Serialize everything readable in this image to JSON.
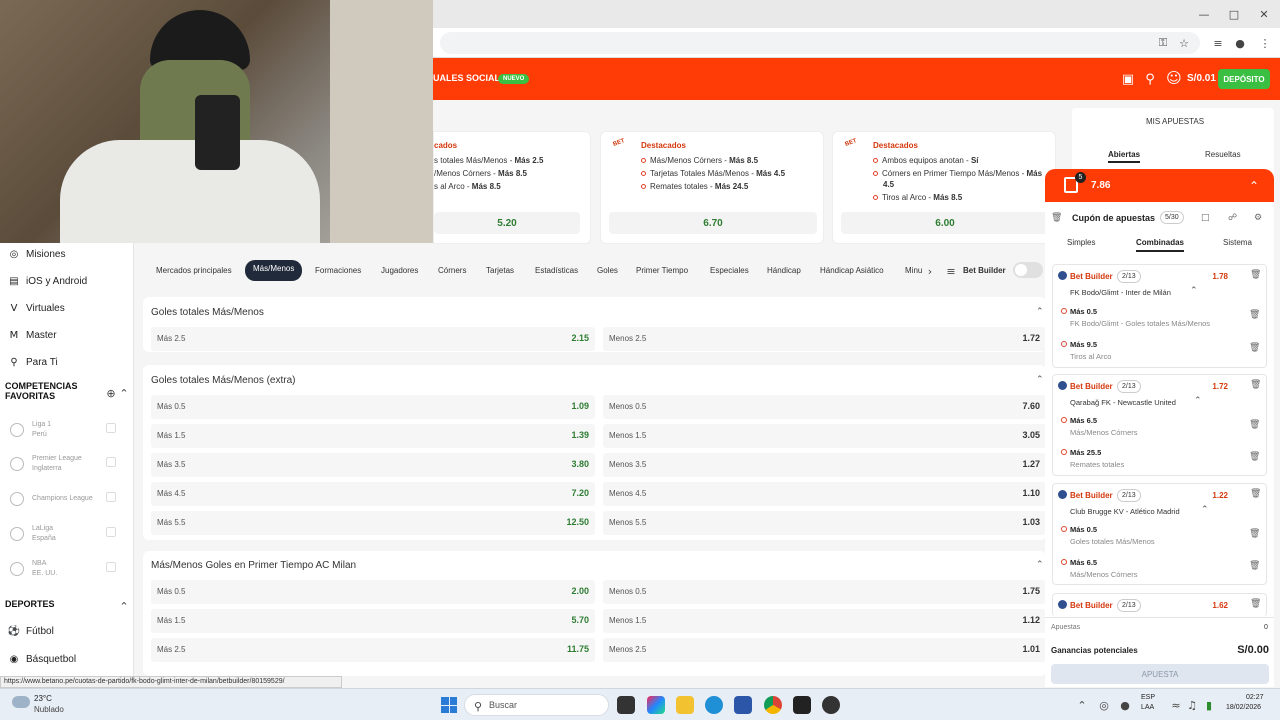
{
  "header": {
    "nav_partial": "UALES",
    "social": "SOCIAL",
    "nuevo_badge": "NUEVO",
    "balance": "S/0.01",
    "deposit": "DEPÓSITO"
  },
  "featured": [
    {
      "title": "cados",
      "lines": [
        {
          "text": "s totales Más/Menos - ",
          "bold": "Más 2.5"
        },
        {
          "text": "/Menos Córners - ",
          "bold": "Más 8.5"
        },
        {
          "text": "s al Arco - ",
          "bold": "Más 8.5"
        }
      ],
      "odds": "5.20"
    },
    {
      "title": "Destacados",
      "lines": [
        {
          "text": "Más/Menos Córners - ",
          "bold": "Más 8.5"
        },
        {
          "text": "Tarjetas Totales Más/Menos - ",
          "bold": "Más 4.5"
        },
        {
          "text": "Remates totales - ",
          "bold": "Más 24.5"
        }
      ],
      "odds": "6.70"
    },
    {
      "title": "Destacados",
      "lines": [
        {
          "text": "Ambos equipos anotan - ",
          "bold": "Sí"
        },
        {
          "text": "Córners en Primer Tiempo Más/Menos - ",
          "bold": "Más"
        },
        {
          "text": "",
          "bold": "4.5"
        },
        {
          "text": "Tiros al Arco - ",
          "bold": "Más 8.5"
        }
      ],
      "odds": "6.00"
    }
  ],
  "sidebar": {
    "items": [
      {
        "label": "Misiones",
        "icon": "target-icon"
      },
      {
        "label": "iOS y Android",
        "icon": "phone-icon"
      },
      {
        "label": "Virtuales",
        "icon": "virtual-icon"
      },
      {
        "label": "Master",
        "icon": "master-icon"
      },
      {
        "label": "Para Ti",
        "icon": "search-icon"
      }
    ],
    "competitions_title": "COMPETENCIAS FAVORITAS",
    "competitions": [
      {
        "name": "Liga 1",
        "sub": "Perú"
      },
      {
        "name": "Premier League",
        "sub": "Inglaterra"
      },
      {
        "name": "Champions League",
        "sub": ""
      },
      {
        "name": "LaLiga",
        "sub": "España"
      },
      {
        "name": "NBA",
        "sub": "EE. UU."
      }
    ],
    "sports_title": "DEPORTES",
    "sports": [
      {
        "label": "Fútbol"
      },
      {
        "label": "Básquetbol"
      }
    ]
  },
  "tabs": [
    "Mercados principales",
    "Más/Menos",
    "Formaciones",
    "Jugadores",
    "Córners",
    "Tarjetas",
    "Estadísticas",
    "Goles",
    "Primer Tiempo",
    "Especiales",
    "Hándicap",
    "Hándicap Asiático",
    "Minu"
  ],
  "bet_builder_toggle": "Bet Builder",
  "markets": [
    {
      "title": "Goles totales Más/Menos",
      "rows": [
        {
          "l": "Más 2.5",
          "lo": "2.15",
          "r": "Menos 2.5",
          "ro": "1.72"
        }
      ]
    },
    {
      "title": "Goles totales Más/Menos (extra)",
      "rows": [
        {
          "l": "Más 0.5",
          "lo": "1.09",
          "r": "Menos 0.5",
          "ro": "7.60"
        },
        {
          "l": "Más 1.5",
          "lo": "1.39",
          "r": "Menos 1.5",
          "ro": "3.05"
        },
        {
          "l": "Más 3.5",
          "lo": "3.80",
          "r": "Menos 3.5",
          "ro": "1.27"
        },
        {
          "l": "Más 4.5",
          "lo": "7.20",
          "r": "Menos 4.5",
          "ro": "1.10"
        },
        {
          "l": "Más 5.5",
          "lo": "12.50",
          "r": "Menos 5.5",
          "ro": "1.03"
        }
      ]
    },
    {
      "title": "Más/Menos Goles en Primer Tiempo AC Milan",
      "rows": [
        {
          "l": "Más 0.5",
          "lo": "2.00",
          "r": "Menos 0.5",
          "ro": "1.75"
        },
        {
          "l": "Más 1.5",
          "lo": "5.70",
          "r": "Menos 1.5",
          "ro": "1.12"
        },
        {
          "l": "Más 2.5",
          "lo": "11.75",
          "r": "Menos 2.5",
          "ro": "1.01"
        }
      ]
    }
  ],
  "mis_apuestas": {
    "title": "MIS APUESTAS",
    "tab_open": "Abiertas",
    "tab_resolved": "Resueltas"
  },
  "cupon": {
    "count": "5",
    "total_odds": "7.86",
    "title": "Cupón de apuestas",
    "slots": "5/30",
    "tabs": [
      "Simples",
      "Combinadas",
      "Sistema"
    ],
    "cards": [
      {
        "label": "Bet Builder",
        "count": "2/13",
        "odd": "1.78",
        "match": "FK Bodo/Glimt - Inter de Milán",
        "sels": [
          {
            "t": "Más 0.5",
            "s": "FK Bodo/Glimt - Goles totales Más/Menos"
          },
          {
            "t": "Más 9.5",
            "s": "Tiros al Arco"
          }
        ]
      },
      {
        "label": "Bet Builder",
        "count": "2/13",
        "odd": "1.72",
        "match": "Qarabağ FK - Newcastle United",
        "sels": [
          {
            "t": "Más 6.5",
            "s": "Más/Menos Córners"
          },
          {
            "t": "Más 25.5",
            "s": "Remates totales"
          }
        ]
      },
      {
        "label": "Bet Builder",
        "count": "2/13",
        "odd": "1.22",
        "match": "Club Brugge KV - Atlético Madrid",
        "sels": [
          {
            "t": "Más 0.5",
            "s": "Goles totales Más/Menos"
          },
          {
            "t": "Más 6.5",
            "s": "Más/Menos Córners"
          }
        ]
      },
      {
        "label": "Bet Builder",
        "count": "2/13",
        "odd": "1.62",
        "match": "",
        "sels": []
      }
    ],
    "apuestas_label": "Apuestas",
    "apuestas_value": "0",
    "ganancias_label": "Ganancias potenciales",
    "ganancias_value": "S/0.00",
    "apuesta_button": "APUESTA"
  },
  "status_url": "https://www.betano.pe/cuotas-de-partido/fk-bodo-glimt-inter-de-milan/betbuilder/80159529/",
  "taskbar": {
    "temp": "23°C",
    "weather": "Nublado",
    "search": "Buscar",
    "lang": "ESP",
    "lang_sub": "LAA",
    "time": "02:27",
    "date": "18/02/2026"
  }
}
